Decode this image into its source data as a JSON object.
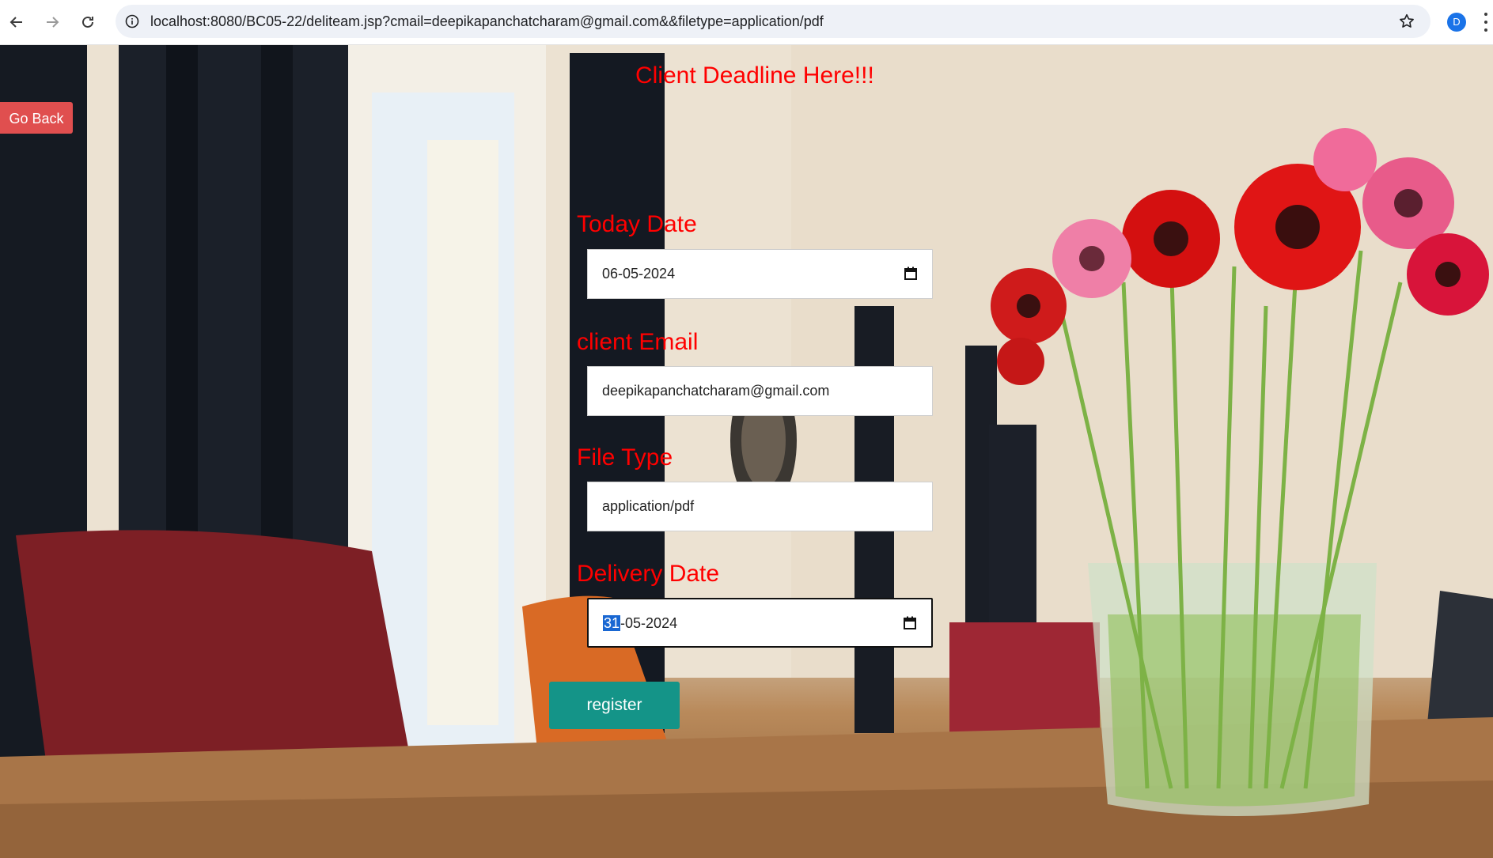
{
  "browser": {
    "url": "localhost:8080/BC05-22/deliteam.jsp?cmail=deepikapanchatcharam@gmail.com&&filetype=application/pdf",
    "profile_initial": "D"
  },
  "page": {
    "go_back_label": "Go Back",
    "title": "Client Deadline Here!!!",
    "fields": [
      {
        "label": "Today Date",
        "value": "06-05-2024"
      },
      {
        "label": "client Email",
        "value": "deepikapanchatcharam@gmail.com"
      },
      {
        "label": "File Type",
        "value": "application/pdf"
      },
      {
        "label": "Delivery Date",
        "value_selected": "31",
        "value_rest": "-05-2024"
      }
    ],
    "register_label": "register"
  }
}
